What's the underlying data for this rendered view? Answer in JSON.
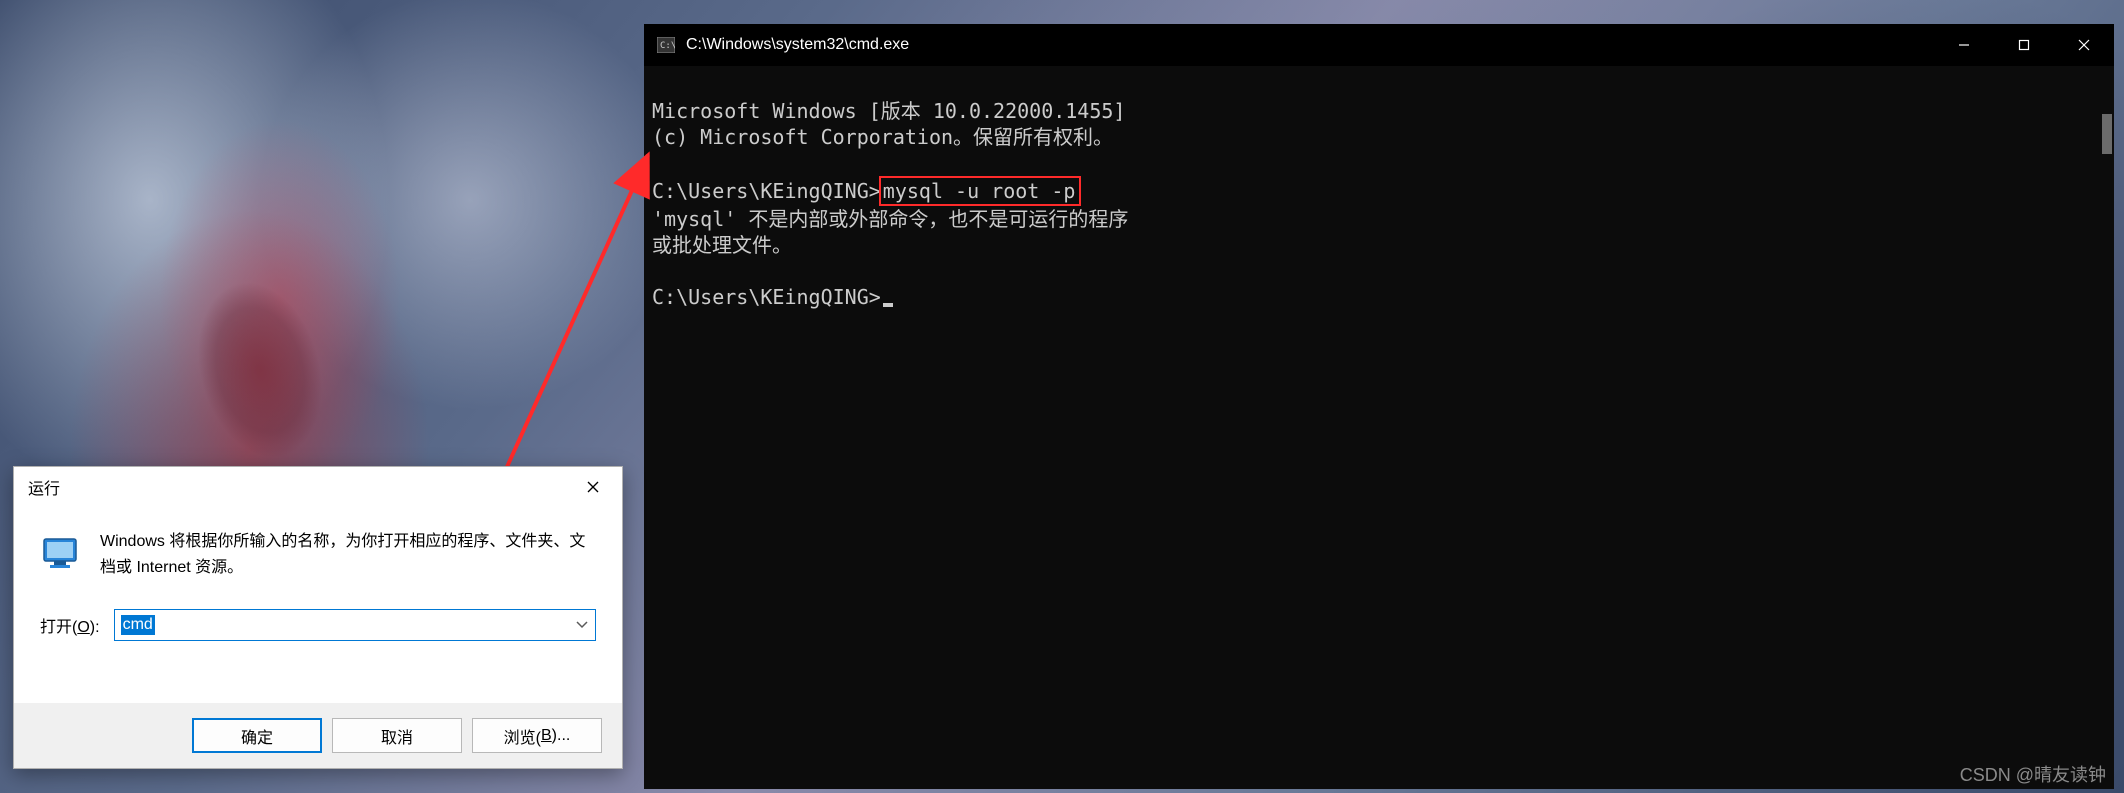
{
  "cmd": {
    "title": "C:\\Windows\\system32\\cmd.exe",
    "line1": "Microsoft Windows [版本 10.0.22000.1455]",
    "line2": "(c) Microsoft Corporation。保留所有权利。",
    "prompt1_prefix": "C:\\Users\\KEingQING>",
    "prompt1_cmd": "mysql -u root -p",
    "error1": "'mysql' 不是内部或外部命令，也不是可运行的程序",
    "error2": "或批处理文件。",
    "prompt2": "C:\\Users\\KEingQING>"
  },
  "run": {
    "title": "运行",
    "description": "Windows 将根据你所输入的名称，为你打开相应的程序、文件夹、文档或 Internet 资源。",
    "open_label_pre": "打开(",
    "open_label_key": "O",
    "open_label_post": "):",
    "input_value": "cmd",
    "ok": "确定",
    "cancel": "取消",
    "browse_pre": "浏览(",
    "browse_key": "B",
    "browse_post": ")..."
  },
  "watermark": "CSDN @晴友读钟"
}
